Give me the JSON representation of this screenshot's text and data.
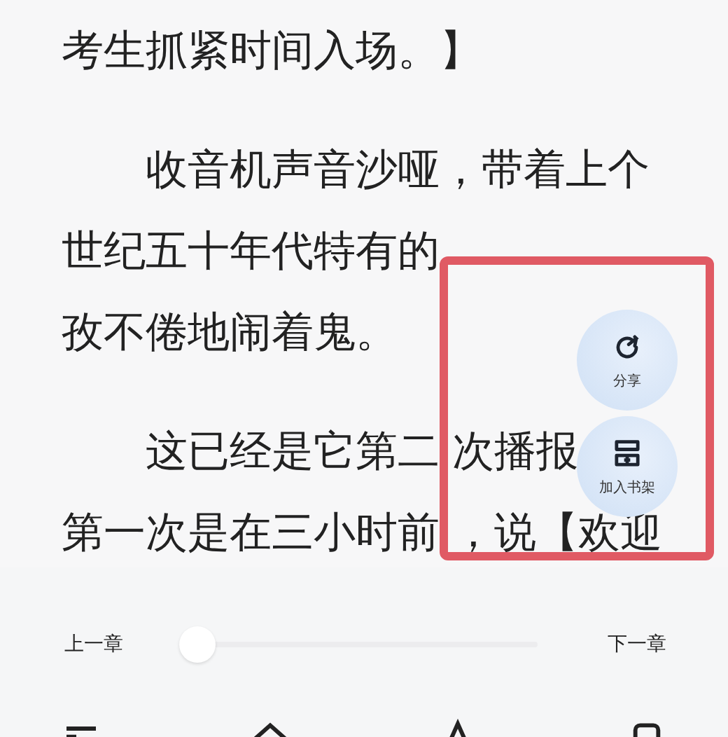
{
  "paragraphs": [
    {
      "lines": [
        [
          "考生抓紧时间入场。】"
        ]
      ]
    },
    {
      "lines": [
        [
          "　　收音机声音沙哑，带着上个"
        ],
        [
          "世纪五十年代特有的"
        ],
        [
          "孜不倦地闹着鬼。"
        ]
      ]
    },
    {
      "lines": [
        [
          "　　这已经是它第二",
          "次播报"
        ],
        [
          "第一次是在三小时前",
          "，说【欢迎"
        ]
      ]
    }
  ],
  "floating_actions": [
    {
      "kind": "share",
      "label": "分享"
    },
    {
      "kind": "bookshelf",
      "label": "加入书架"
    }
  ],
  "chapter_bar": {
    "previous": "上一章",
    "next": "下一章",
    "progress": {
      "level": 0
    }
  },
  "toolbar": [
    {
      "kind": "list"
    },
    {
      "kind": "roof"
    },
    {
      "kind": "letter"
    },
    {
      "kind": "square"
    }
  ]
}
